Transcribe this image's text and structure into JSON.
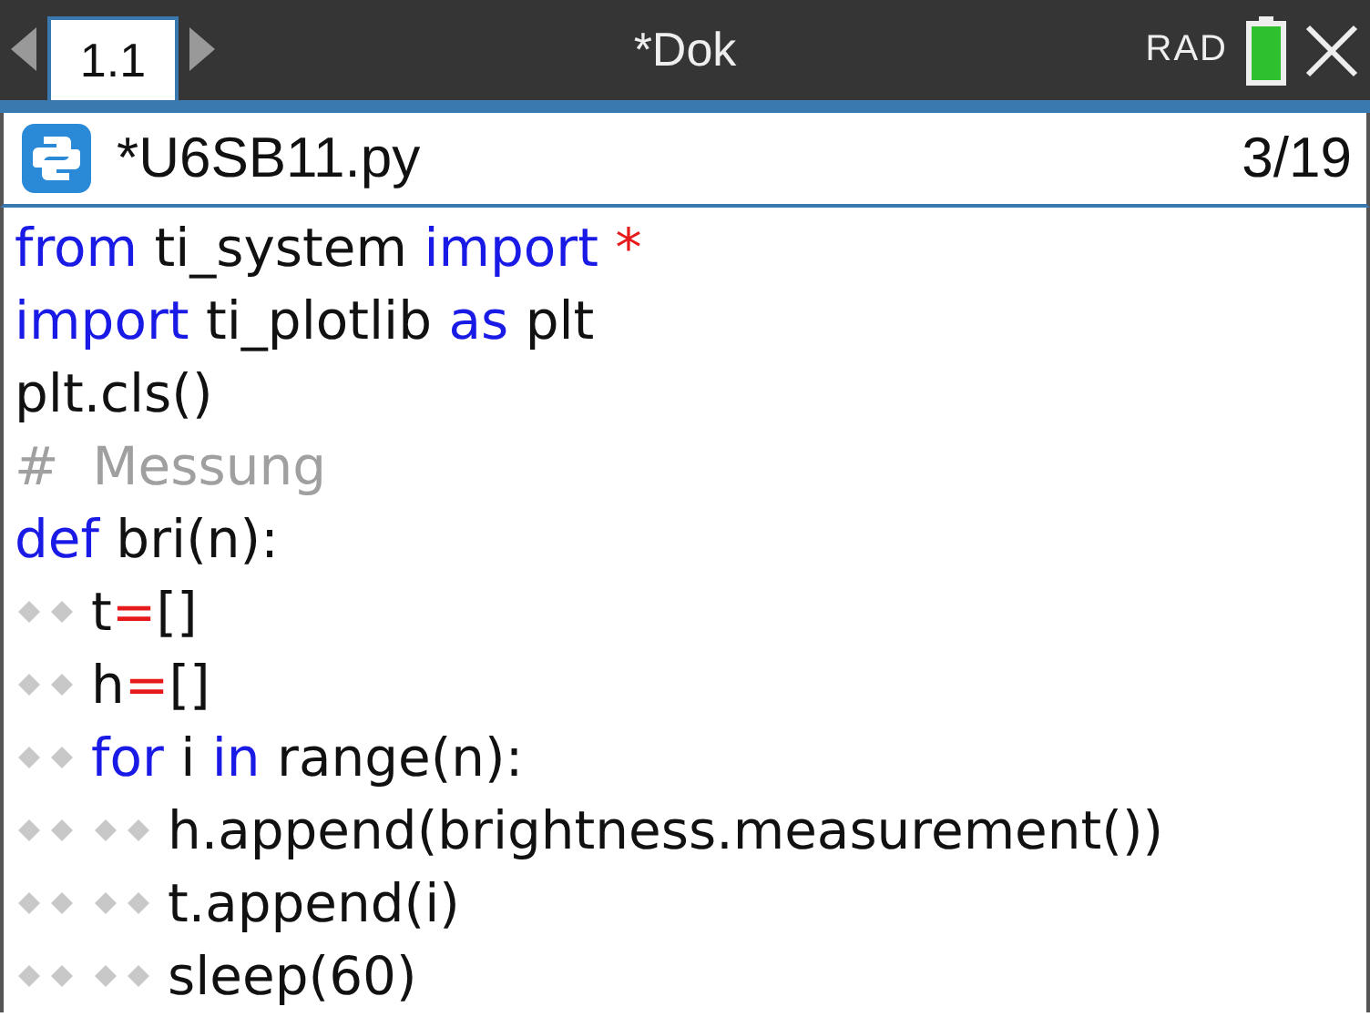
{
  "top_bar": {
    "tab": {
      "label": "1.1",
      "selected": true
    },
    "title": "*Dok",
    "mode": "RAD"
  },
  "editor": {
    "file_name": "*U6SB11.py",
    "position": "3/19",
    "lines": [
      {
        "tokens": [
          {
            "text": "from",
            "kind": "keyword"
          },
          {
            "text": " ti_system ",
            "kind": "plain"
          },
          {
            "text": "import",
            "kind": "keyword"
          },
          {
            "text": " *",
            "kind": "operator"
          }
        ]
      },
      {
        "tokens": [
          {
            "text": "import",
            "kind": "keyword"
          },
          {
            "text": " ti_plotlib ",
            "kind": "plain"
          },
          {
            "text": "as",
            "kind": "keyword"
          },
          {
            "text": " plt",
            "kind": "plain"
          }
        ]
      },
      {
        "tokens": [
          {
            "text": "plt.cls()",
            "kind": "plain"
          }
        ]
      },
      {
        "tokens": [
          {
            "text": "#  Messung",
            "kind": "comment"
          }
        ]
      },
      {
        "tokens": [
          {
            "text": "def",
            "kind": "keyword"
          },
          {
            "text": " bri(n):",
            "kind": "plain"
          }
        ],
        "children": [
          {
            "tokens": [
              {
                "text": "t",
                "kind": "plain"
              },
              {
                "text": "=",
                "kind": "operator"
              },
              {
                "text": "[]",
                "kind": "plain"
              }
            ]
          },
          {
            "tokens": [
              {
                "text": "h",
                "kind": "plain"
              },
              {
                "text": "=",
                "kind": "operator"
              },
              {
                "text": "[]",
                "kind": "plain"
              }
            ]
          },
          {
            "tokens": [
              {
                "text": "for",
                "kind": "keyword"
              },
              {
                "text": " i ",
                "kind": "plain"
              },
              {
                "text": "in",
                "kind": "keyword"
              },
              {
                "text": " range(n):",
                "kind": "plain"
              }
            ],
            "children": [
              {
                "tokens": [
                  {
                    "text": "h.append(brightness.measurement())",
                    "kind": "plain"
                  }
                ]
              },
              {
                "tokens": [
                  {
                    "text": "t.append(i)",
                    "kind": "plain"
                  }
                ]
              },
              {
                "tokens": [
                  {
                    "text": "sleep(60)",
                    "kind": "plain"
                  }
                ]
              }
            ]
          }
        ]
      }
    ]
  }
}
